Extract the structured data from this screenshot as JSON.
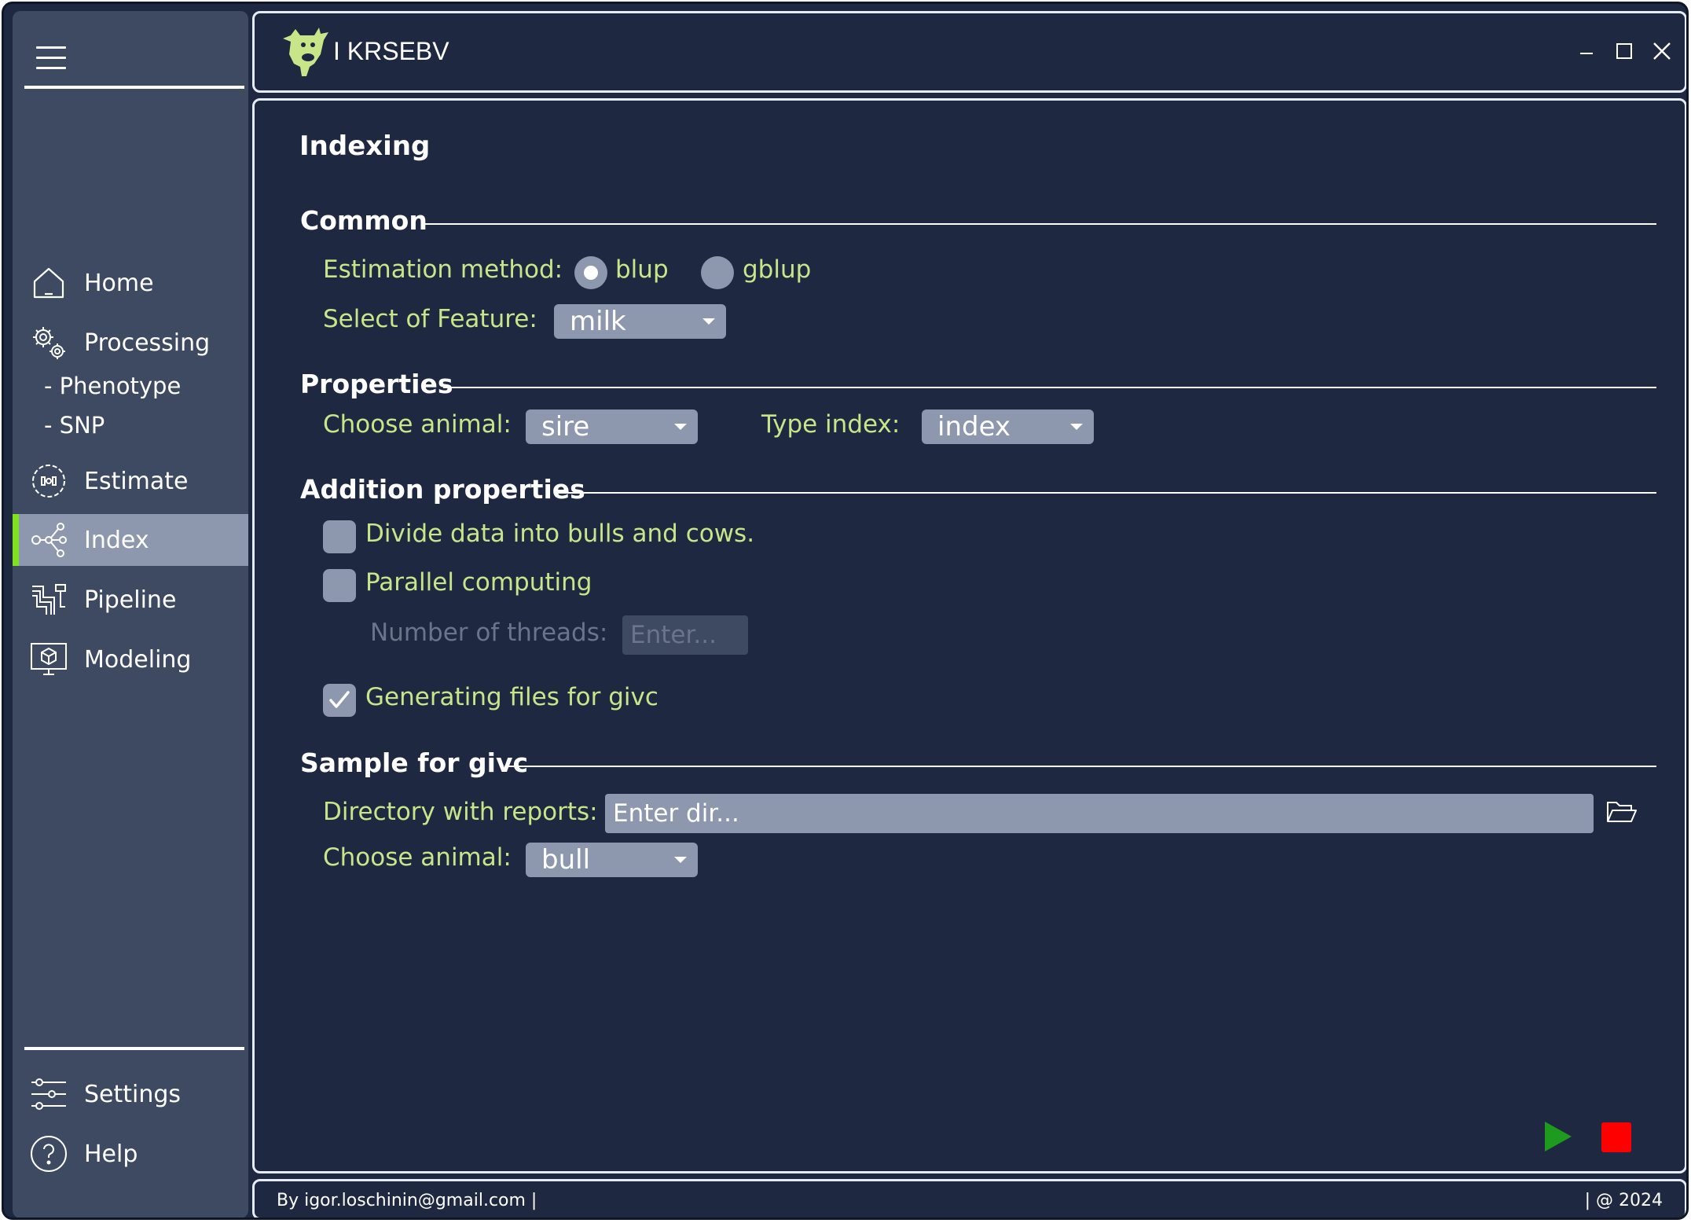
{
  "app": {
    "title": "I KRSEBV"
  },
  "sidebar": {
    "items": [
      {
        "label": "Home",
        "icon": "home-icon"
      },
      {
        "label": "Processing",
        "icon": "gears-icon"
      },
      {
        "label": "Estimate",
        "icon": "estimate-icon"
      },
      {
        "label": "Index",
        "icon": "network-icon",
        "active": true
      },
      {
        "label": "Pipeline",
        "icon": "pipeline-icon"
      },
      {
        "label": "Modeling",
        "icon": "modeling-icon"
      }
    ],
    "sub_items": [
      "- Phenotype",
      "- SNP"
    ],
    "bottom": [
      {
        "label": "Settings",
        "icon": "sliders-icon"
      },
      {
        "label": "Help",
        "icon": "help-icon"
      }
    ]
  },
  "main": {
    "title": "Indexing",
    "common": {
      "title": "Common",
      "estimation_label": "Estimation method:",
      "radio_options": [
        "blup",
        "gblup"
      ],
      "radio_selected": "blup",
      "feature_label": "Select of Feature:",
      "feature_value": "milk"
    },
    "properties": {
      "title": "Properties",
      "animal_label": "Choose animal:",
      "animal_value": "sire",
      "type_label": "Type index:",
      "type_value": "index"
    },
    "addition": {
      "title": "Addition properties",
      "divide_label": "Divide data into bulls and cows.",
      "divide_checked": false,
      "parallel_label": "Parallel computing",
      "parallel_checked": false,
      "threads_label": "Number of threads:",
      "threads_placeholder": "Enter...",
      "givc_label": "Generating files for givc",
      "givc_checked": true
    },
    "sample": {
      "title": "Sample for givc",
      "dir_label": "Directory with reports:",
      "dir_placeholder": "Enter dir...",
      "animal_label": "Choose animal:",
      "animal_value": "bull"
    }
  },
  "status": {
    "left": "By igor.loschinin@gmail.com |",
    "right": "| @ 2024"
  },
  "colors": {
    "background": "#1e2840",
    "sidebar": "#3d4a61",
    "accent_green": "#7ee21f",
    "label_green": "#c8e58a",
    "control_grey": "#8d97ad",
    "run": "#1e9a1e",
    "stop": "#ff0000"
  }
}
